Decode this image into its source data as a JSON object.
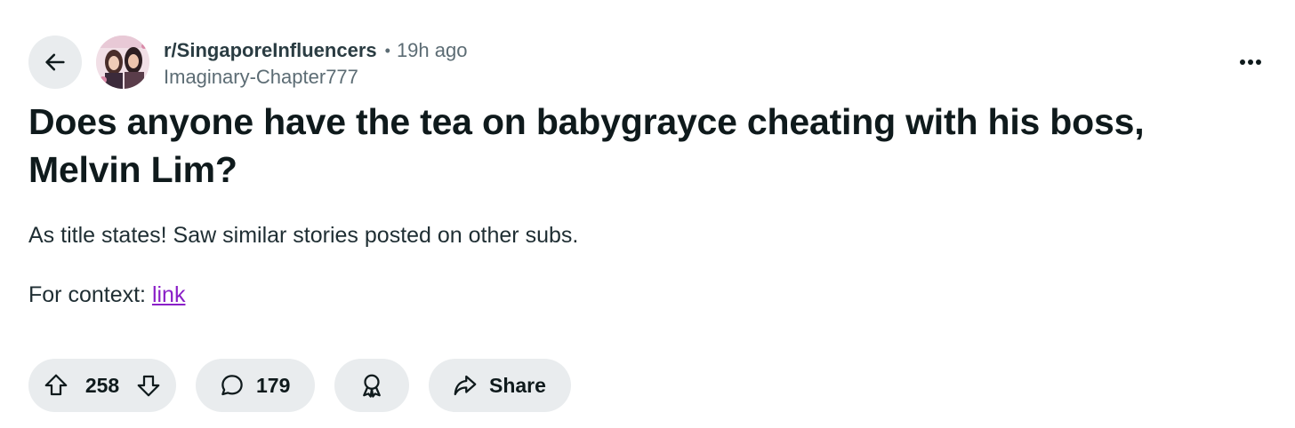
{
  "post": {
    "subreddit": "r/SingaporeInfluencers",
    "separator": "•",
    "time_ago": "19h ago",
    "author": "Imaginary-Chapter777",
    "title": "Does anyone have the tea on babygrayce cheating with his boss, Melvin Lim?",
    "body": "As title states! Saw similar stories posted on other subs.",
    "context_label": "For context:",
    "context_link": "link"
  },
  "actions": {
    "upvote_count": "258",
    "comment_count": "179",
    "share_label": "Share"
  },
  "icons": {
    "back": "arrow-left-icon",
    "more": "more-horizontal-icon",
    "upvote": "upvote-arrow-icon",
    "downvote": "downvote-arrow-icon",
    "comment": "comment-bubble-icon",
    "award": "award-icon",
    "share": "share-arrow-icon"
  },
  "colors": {
    "link": "#8a1fc7",
    "pill_background": "#e9ecee",
    "text_primary": "#0f1a1c",
    "text_secondary": "#5c6c74"
  }
}
